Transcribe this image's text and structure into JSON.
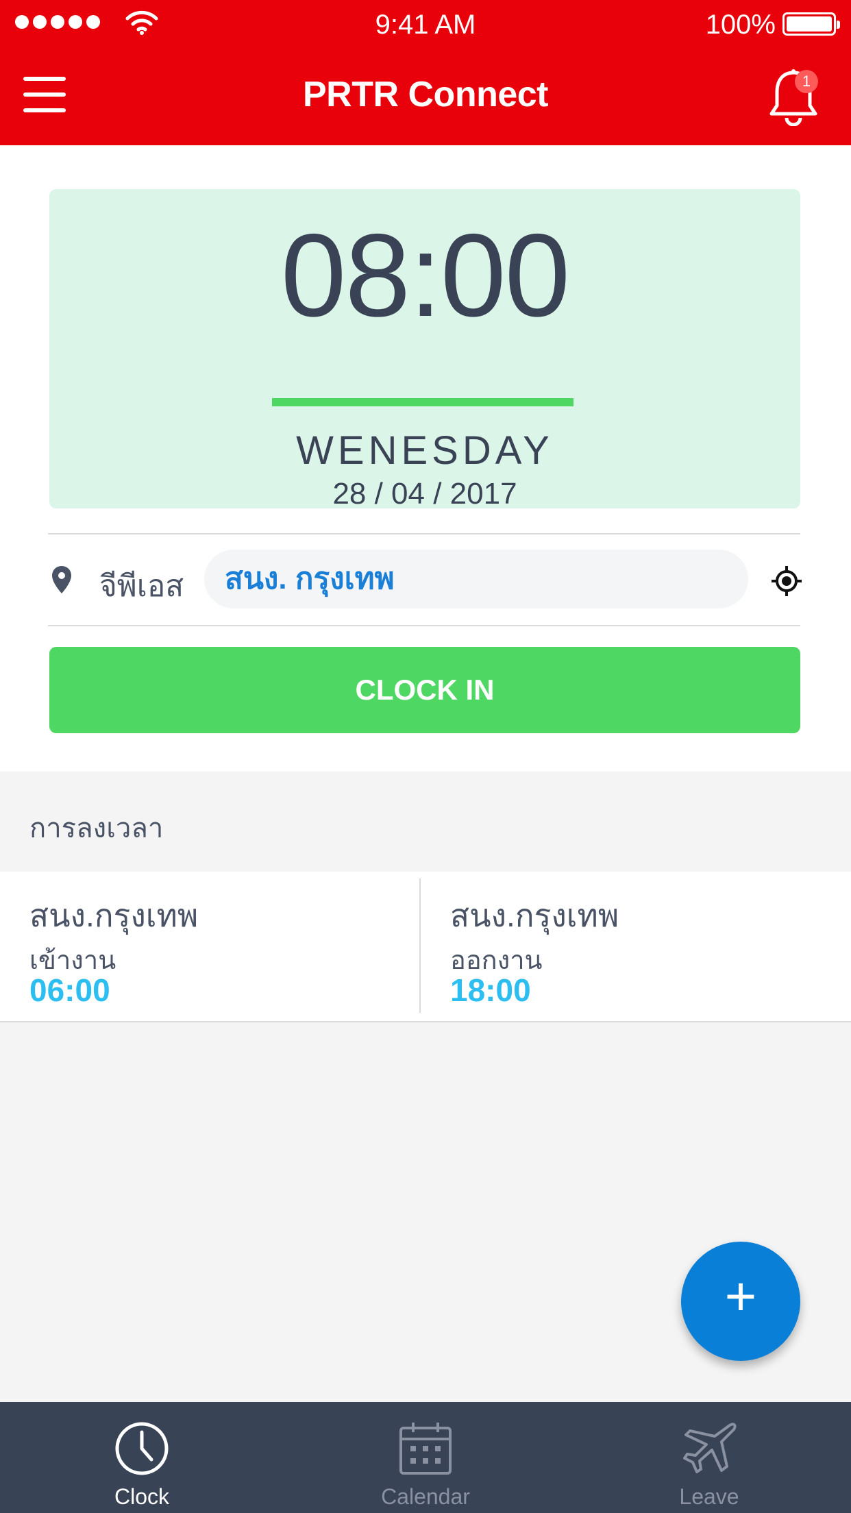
{
  "status_bar": {
    "time": "9:41 AM",
    "battery_percent": "100%",
    "signal_dots": 5,
    "battery_level": 1.0
  },
  "header": {
    "title": "PRTR Connect",
    "notification_count": "1",
    "menu_icon": "hamburger-icon",
    "bell_icon": "bell-icon"
  },
  "clock_card": {
    "time": "08:00",
    "day": "WENESDAY",
    "date": "28 / 04 / 2017"
  },
  "location": {
    "label": "จีพีเอส",
    "value": "สนง. กรุงเทพ",
    "pin_icon": "map-pin-icon",
    "locate_icon": "crosshair-icon"
  },
  "clock_in_button": "CLOCK IN",
  "time_log": {
    "title": "การลงเวลา",
    "entries": [
      {
        "place": "สนง.กรุงเทพ",
        "type": "เข้างาน",
        "time": "06:00"
      },
      {
        "place": "สนง.กรุงเทพ",
        "type": "ออกงาน",
        "time": "18:00"
      }
    ]
  },
  "fab": {
    "label": "+"
  },
  "tabs": [
    {
      "label": "Clock",
      "icon": "clock-icon",
      "active": true
    },
    {
      "label": "Calendar",
      "icon": "calendar-icon",
      "active": false
    },
    {
      "label": "Leave",
      "icon": "airplane-icon",
      "active": false
    }
  ],
  "colors": {
    "brand_red": "#e8000b",
    "success_green": "#4fd764",
    "card_green": "#dbf5e8",
    "link_blue": "#1a7fd6",
    "time_blue": "#2cbef0",
    "fab_blue": "#0a7fd8",
    "tabbar_dark": "#394356"
  }
}
